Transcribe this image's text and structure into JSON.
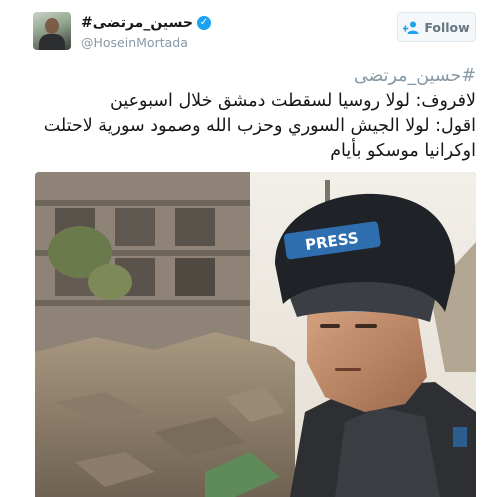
{
  "author": {
    "display_name": "حسين_مرتضى#",
    "handle": "@HoseinMortada",
    "verified_icon": "verified-check-icon"
  },
  "follow_button": {
    "label": "Follow",
    "icon": "add-user-icon"
  },
  "tweet": {
    "hashtag": "#حسين_مرتضى",
    "lines": [
      "لافروف: لولا روسيا لسقطت دمشق خلال اسبوعين",
      "اقول: لولا الجيش السوري وحزب الله وصمود سورية لاحتلت",
      "اوكرانيا موسكو بأيام"
    ]
  },
  "photo": {
    "helmet_label": "PRESS"
  },
  "colors": {
    "text": "#14171a",
    "muted": "#8899a6",
    "verified": "#1da1f2",
    "button_bg": "#f5f8fa",
    "button_border": "#e1e8ed"
  }
}
